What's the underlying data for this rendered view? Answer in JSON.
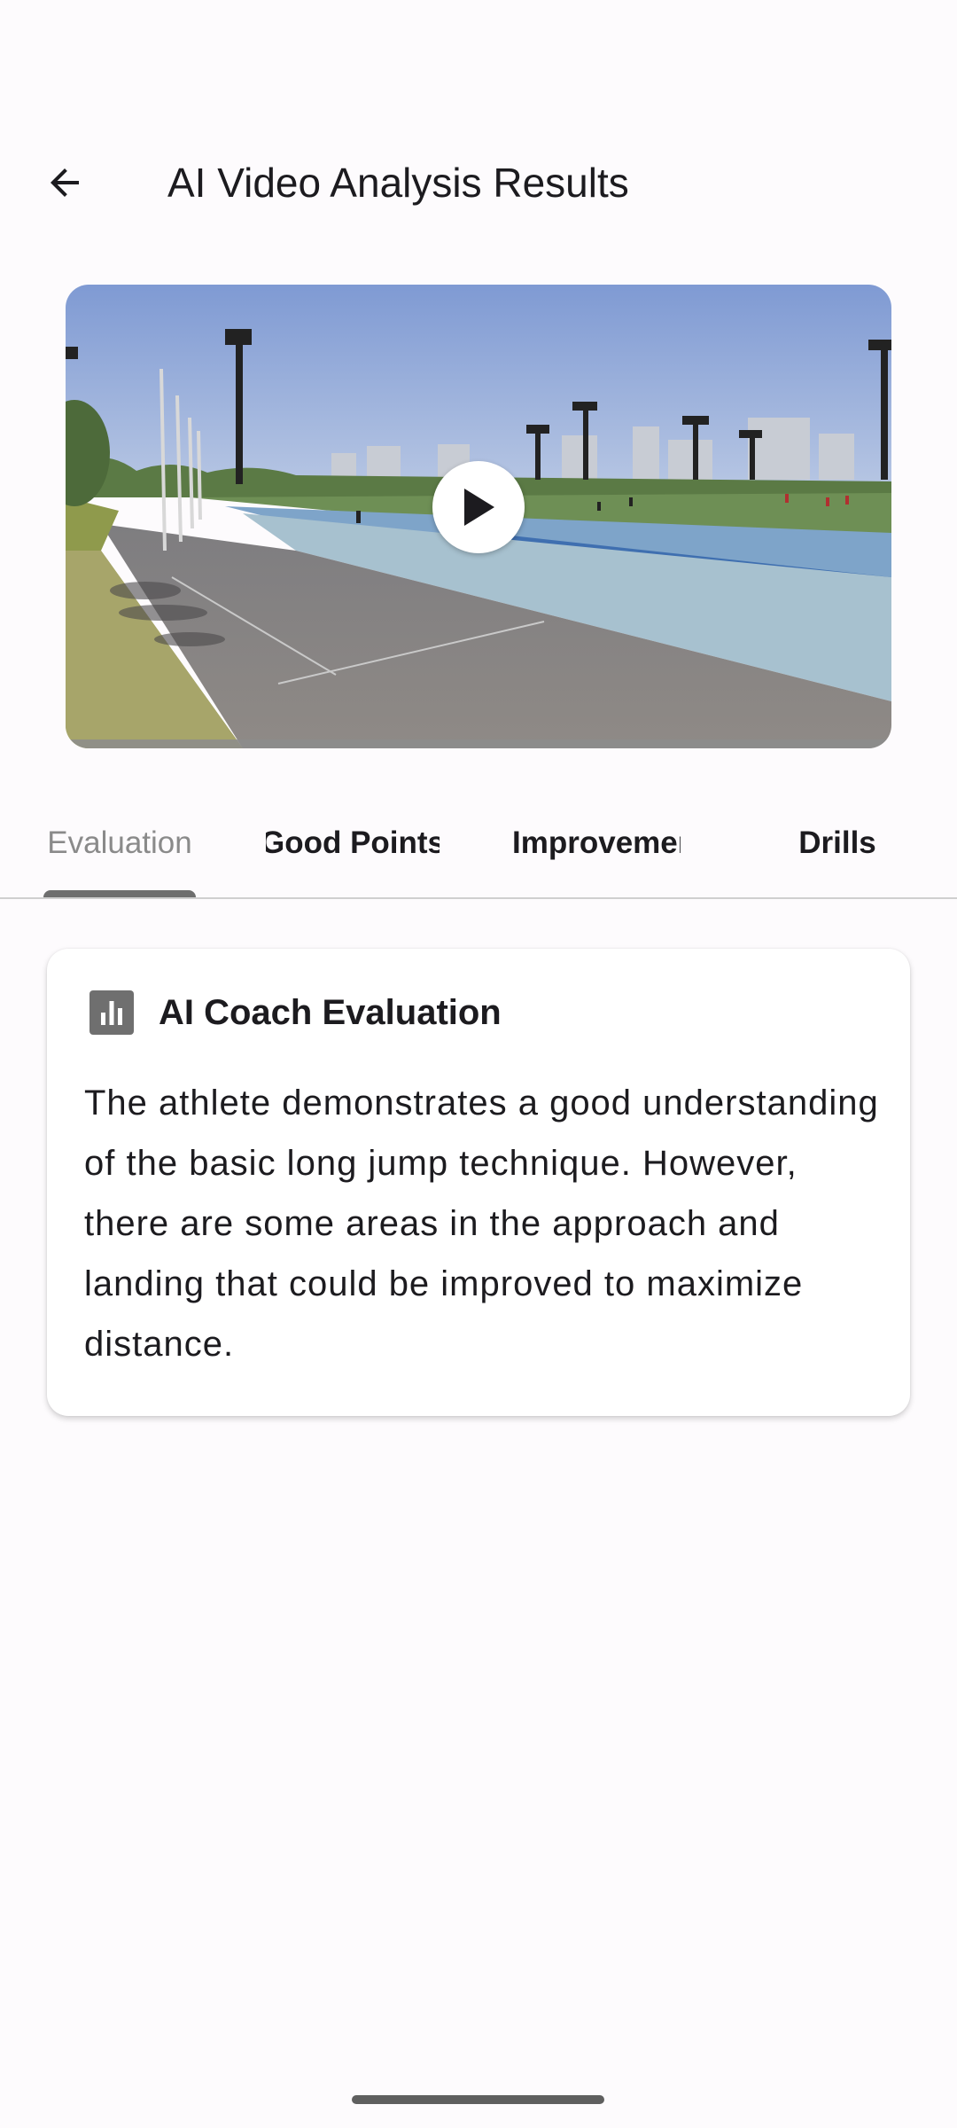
{
  "header": {
    "title": "AI Video Analysis Results",
    "back_icon": "arrow-left-icon"
  },
  "video": {
    "play_icon": "play-icon",
    "progress": 0
  },
  "tabs": [
    {
      "label": "Evaluation",
      "active": true
    },
    {
      "label": "Good Points",
      "active": false
    },
    {
      "label": "Improvements",
      "active": false
    },
    {
      "label": "Drills",
      "active": false
    }
  ],
  "evaluation_card": {
    "icon": "bar-chart-icon",
    "title": "AI Coach Evaluation",
    "body": "The athlete demonstrates a good understanding of the basic long jump technique. However, there are some areas in the approach and landing that could be improved to maximize distance."
  },
  "colors": {
    "background": "#fdfbfd",
    "active_tab_text": "#8a8a8a",
    "indicator": "#6e6e6e",
    "icon_gray": "#6f6f6f"
  }
}
